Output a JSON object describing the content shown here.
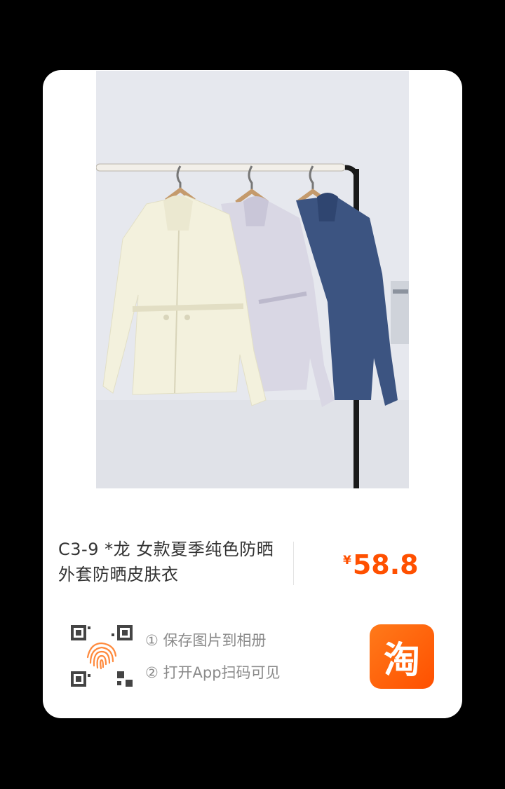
{
  "product": {
    "title": "C3-9 *龙 女款夏季纯色防晒外套防晒皮肤衣",
    "price_currency": "¥",
    "price_value": "58.8"
  },
  "steps": {
    "step1": "① 保存图片到相册",
    "step2": "② 打开App扫码可见"
  },
  "badge": {
    "app_logo_text": "淘"
  },
  "icons": [
    "qr-code-icon",
    "fingerprint-icon",
    "taobao-logo-icon"
  ],
  "colors": {
    "price": "#ff5000",
    "app_badge": "#ff5000",
    "jacket_cream": "#f3f1dd",
    "jacket_lavender": "#d9d7e4",
    "jacket_navy": "#3c5481"
  }
}
